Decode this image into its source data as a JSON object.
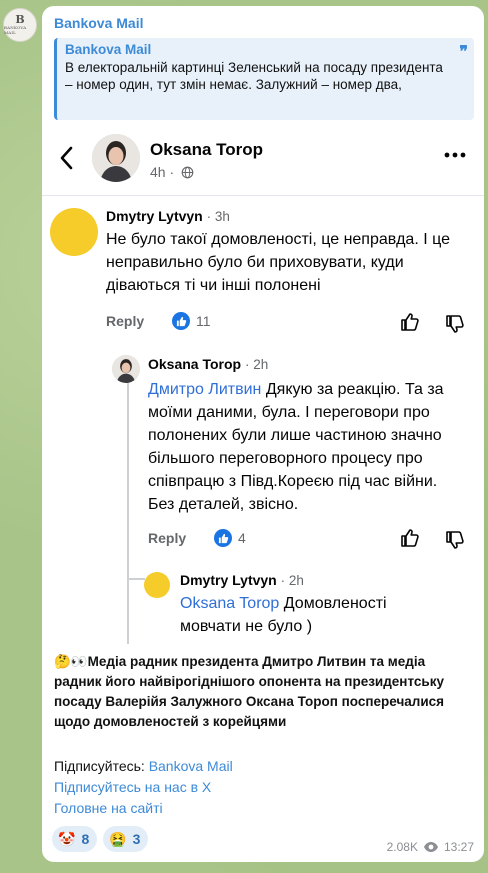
{
  "channel": {
    "avatar_initial": "B",
    "avatar_subtext": "BANKOVA MAIL",
    "sender_name": "Bankova Mail"
  },
  "reply_quote": {
    "title": "Bankova Mail",
    "text": "В електоральній картинці Зеленський на посаду президента – номер один, тут змін немає. Залужний – номер два,",
    "icon": "quote-icon"
  },
  "post": {
    "author": "Oksana Torop",
    "time": "4h",
    "icons": [
      "back-arrow-icon",
      "globe-icon",
      "more-dots-icon"
    ]
  },
  "comments": [
    {
      "author": "Dmytry Lytvyn",
      "time": "3h",
      "text": "Не було такої домовленості, це неправда. І це неправильно було би приховувати, куди діваються ті чи інші полонені",
      "reply_label": "Reply",
      "likes": "11"
    },
    {
      "author": "Oksana Torop",
      "time": "2h",
      "mention": "Дмитро Литвин",
      "text": " Дякую за реакцію. Та за моїми даними, була. І переговори про полонених були лише частиною значно більшого переговорного процесу про співпрацю з Півд.Кореєю під час війни. Без деталей, звісно.",
      "reply_label": "Reply",
      "likes": "4"
    },
    {
      "author": "Dmytry Lytvyn",
      "time": "2h",
      "mention": "Oksana Torop",
      "text": " Домовленості мовчати не було )"
    }
  ],
  "caption": {
    "emoji": "🤔👀",
    "text": "Медіа радник президента Дмитро Литвин та медіа радник його найвірогіднішого опонента на президентську посаду Валерійя Залужного Оксана Тороп посперечалися щодо домовленостей з корейцями"
  },
  "subscribe": {
    "label": "Підписуйтесь: ",
    "link1": "Bankova Mail",
    "link2": "Підписуйтесь на нас в Х",
    "link3": "Головне на сайті"
  },
  "reactions": [
    {
      "emoji": "🤡",
      "count": "8"
    },
    {
      "emoji": "🤮",
      "count": "3"
    }
  ],
  "meta": {
    "views": "2.08K",
    "time": "13:27"
  },
  "colors": {
    "accent": "#3d8ad6",
    "fb_blue": "#1b74e4",
    "mention": "#2f6fd6",
    "chat_bg": "#a8c488"
  }
}
